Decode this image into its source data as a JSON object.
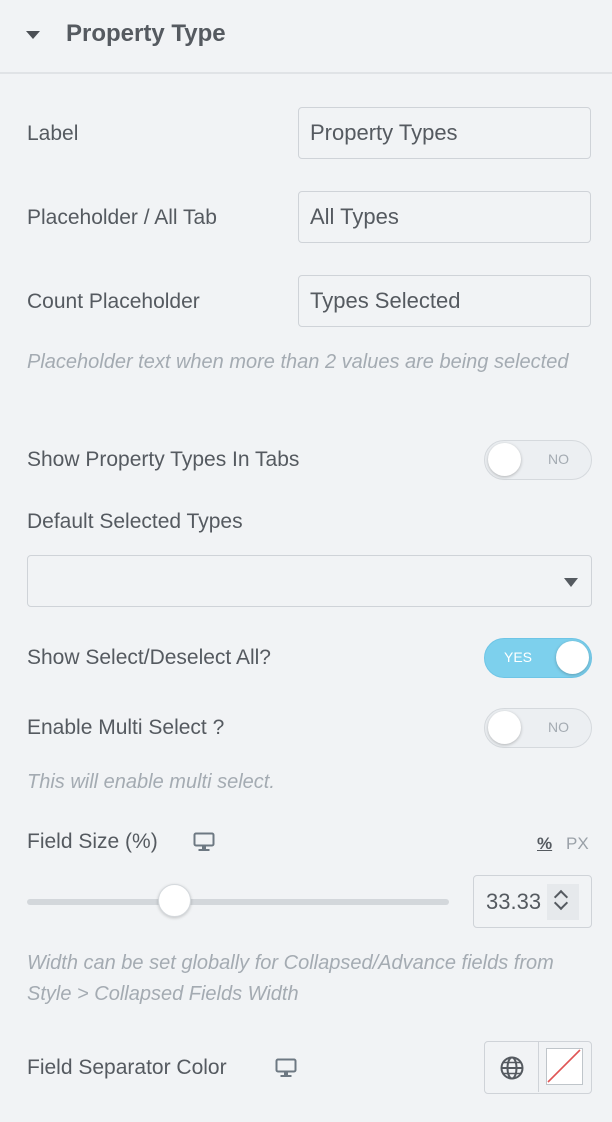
{
  "section": {
    "title": "Property Type",
    "collapse_icon": "caret-down-icon"
  },
  "fields": {
    "label": {
      "label": "Label",
      "value": "Property Types"
    },
    "placeholder": {
      "label": "Placeholder / All Tab",
      "value": "All Types"
    },
    "count_placeholder": {
      "label": "Count Placeholder",
      "value": "Types Selected",
      "help": "Placeholder text when more than 2 values are being selected"
    },
    "show_in_tabs": {
      "label": "Show Property Types In Tabs",
      "state": "NO"
    },
    "default_selected": {
      "label": "Default Selected Types",
      "value": ""
    },
    "select_deselect_all": {
      "label": "Show Select/Deselect All?",
      "state": "YES"
    },
    "multi_select": {
      "label": "Enable Multi Select ?",
      "state": "NO",
      "help": "This will enable multi select."
    },
    "field_size": {
      "label": "Field Size (%)",
      "responsive_icon": "desktop-monitor-icon",
      "units": [
        "%",
        "PX"
      ],
      "active_unit": "%",
      "value": "33.33",
      "slider_fraction": 0.3333,
      "help": "Width can be set globally for Collapsed/Advance fields from Style > Collapsed Fields Width"
    },
    "separator_color": {
      "label": "Field Separator Color",
      "responsive_icon": "desktop-monitor-icon",
      "global_icon": "globe-icon",
      "swatch_icon": "no-color-icon"
    }
  },
  "colors": {
    "toggle_on": "#7dd0ed",
    "text": "#555a60",
    "help_text": "#a4abb2",
    "background": "#f1f3f5"
  }
}
